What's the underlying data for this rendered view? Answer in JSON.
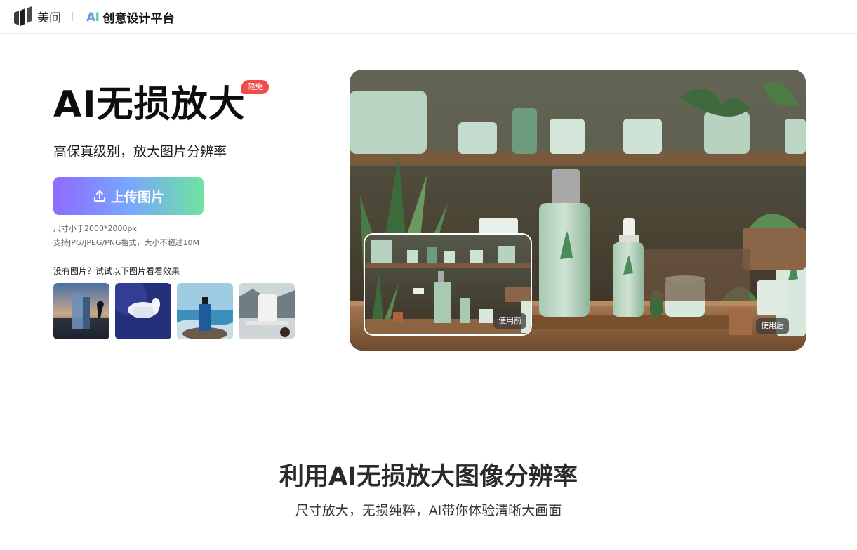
{
  "header": {
    "brand_name": "美间",
    "ai_mark": "AI",
    "product_name": "创意设计平台"
  },
  "hero": {
    "title": "AI无损放大",
    "badge": "限免",
    "subtitle": "高保真级别，放大图片分辨率",
    "upload_button": "上传图片",
    "upload_icon": "upload-icon",
    "size_hint": "尺寸小于2000*2000px",
    "format_hint": "支持JPG/JPEG/PNG格式，大小不超过10M",
    "sample_label": "没有图片？试试以下图片看看效果",
    "samples": [
      {
        "name": "city-glass-product"
      },
      {
        "name": "earbuds-product"
      },
      {
        "name": "bottle-on-rock-product"
      },
      {
        "name": "humidifier-product"
      }
    ],
    "before_label": "使用前",
    "after_label": "使用后"
  },
  "section": {
    "title": "利用AI无损放大图像分辨率",
    "subtitle": "尺寸放大，无损纯粹，AI带你体验清晰大画面"
  },
  "colors": {
    "badge": "#f04c49",
    "button_gradient": [
      "#8e6bff",
      "#78a6ff",
      "#6fe3a0"
    ],
    "ai_gradient": [
      "#6b8cff",
      "#5ec7a1"
    ]
  }
}
